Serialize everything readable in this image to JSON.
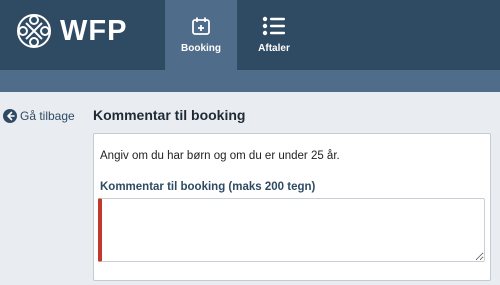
{
  "header": {
    "logo_text": "WFP",
    "nav": [
      {
        "label": "Booking",
        "icon": "calendar-plus-icon",
        "active": true
      },
      {
        "label": "Aftaler",
        "icon": "list-icon",
        "active": false
      }
    ]
  },
  "back": {
    "label": "Gå tilbage",
    "icon": "arrow-left-circle-icon"
  },
  "main": {
    "title": "Kommentar til booking",
    "info": "Angiv om du har børn og om du er under 25 år.",
    "field_label": "Kommentar til booking (maks 200 tegn)",
    "comment_value": "",
    "comment_placeholder": ""
  },
  "colors": {
    "header_bg": "#2f4a63",
    "active_nav_bg": "#4f6d8a",
    "page_bg": "#e9edf1",
    "required_accent": "#c0392b"
  }
}
